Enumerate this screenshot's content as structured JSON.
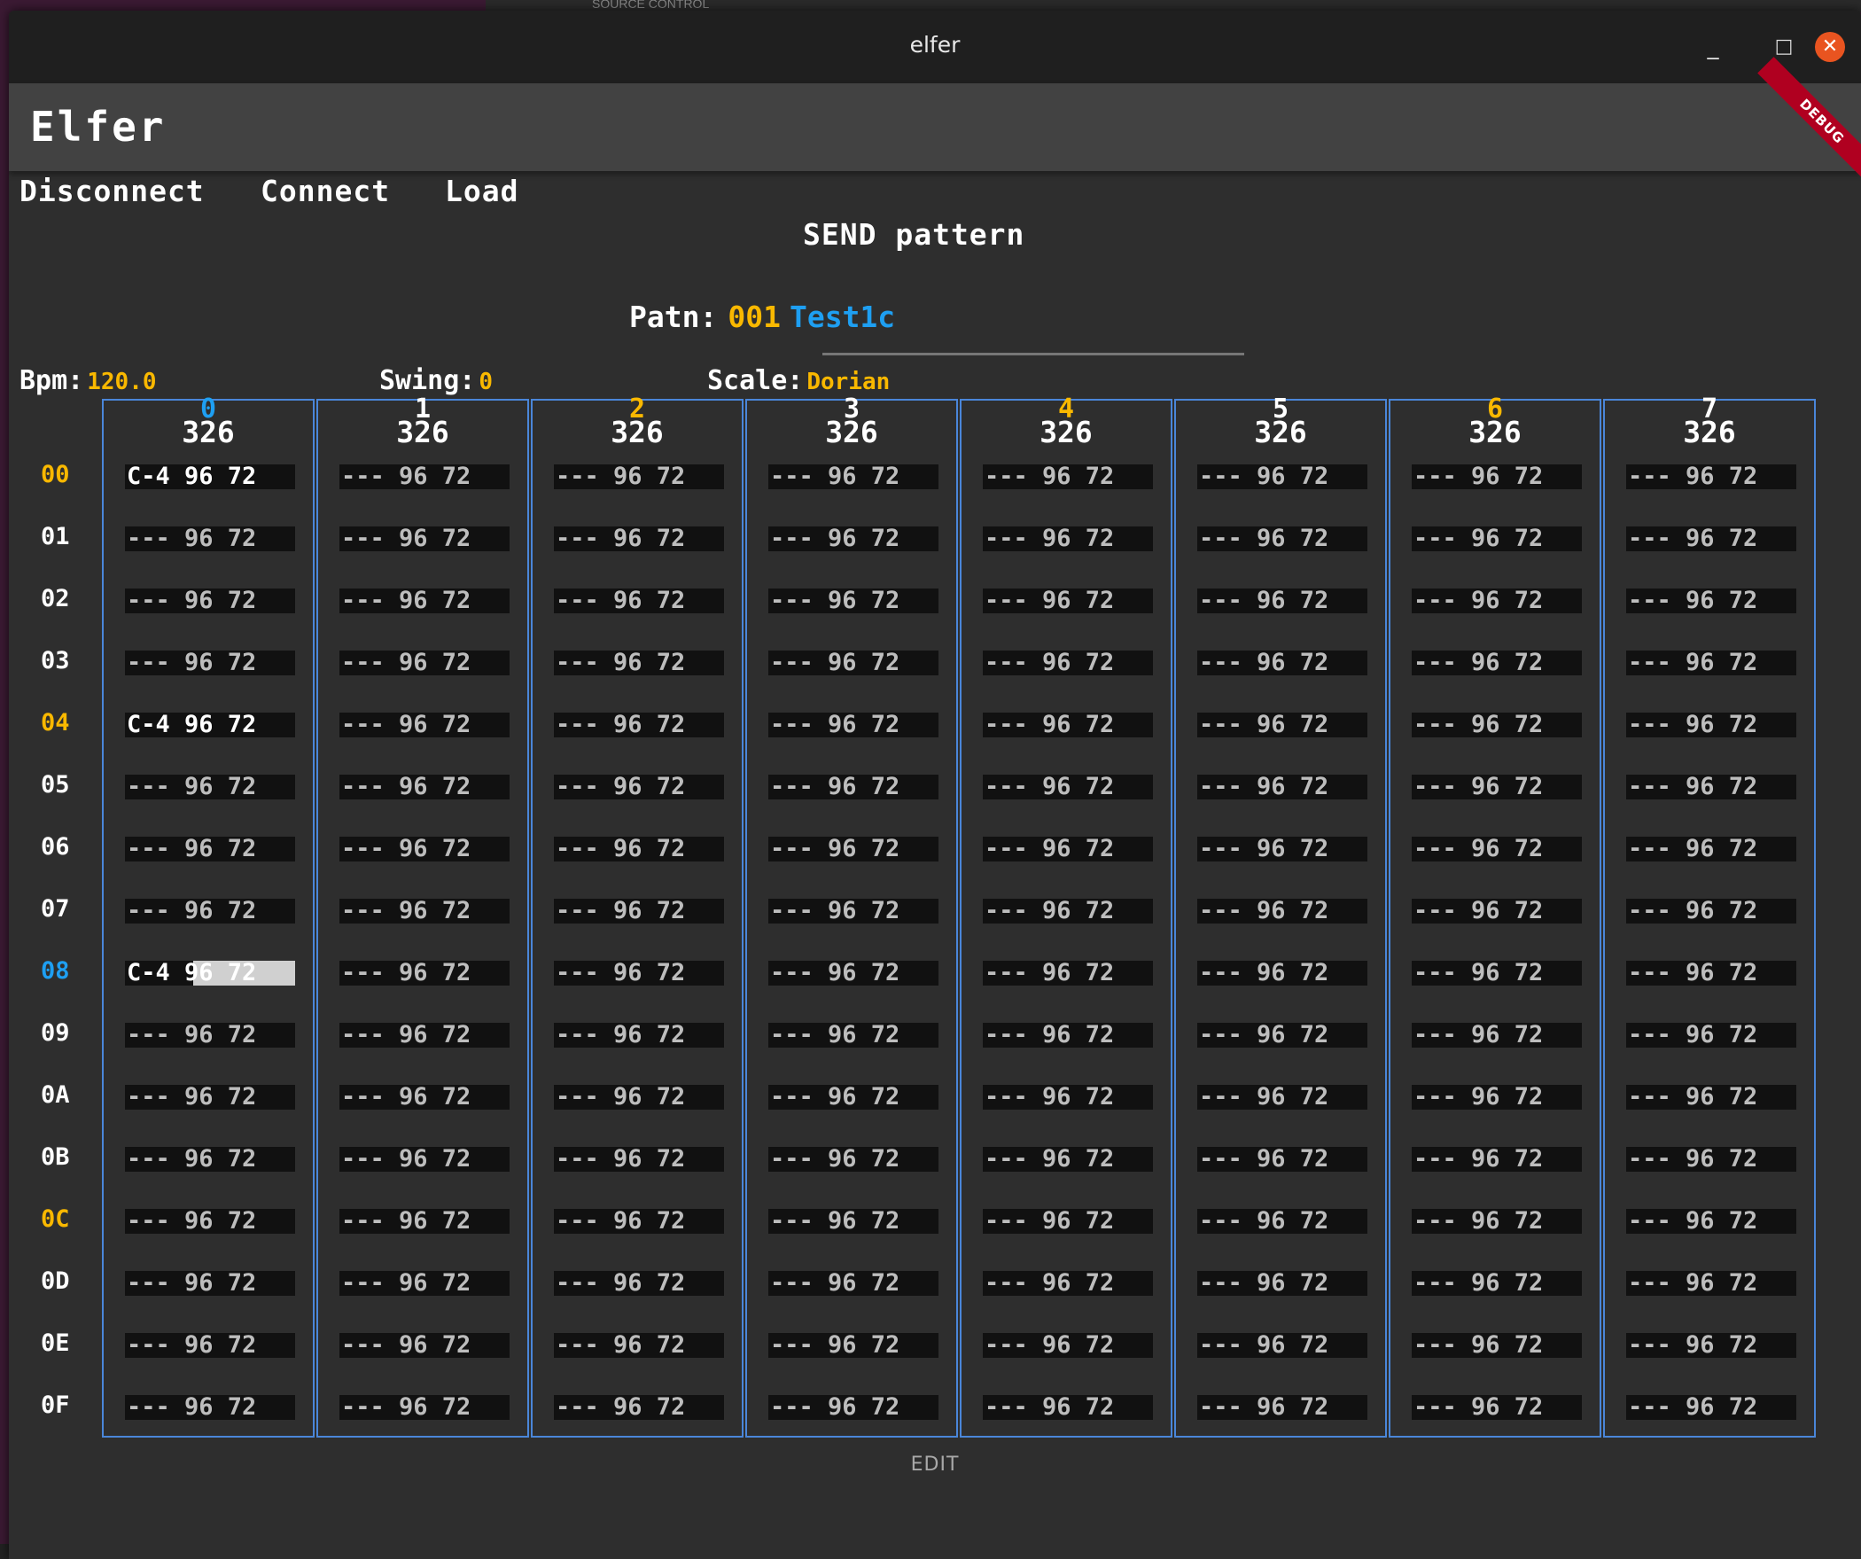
{
  "desktop": {
    "source_control_label": "SOURCE CONTROL"
  },
  "window": {
    "title": "elfer",
    "controls": {
      "minimize": "_",
      "maximize": "□",
      "close": "✕"
    }
  },
  "appbar": {
    "title": "Elfer",
    "debug_badge": "DEBUG"
  },
  "toolbar": {
    "disconnect": "Disconnect",
    "connect": "Connect",
    "load": "Load"
  },
  "send_button": "SEND pattern",
  "pattern": {
    "label": "Patn:",
    "number": "001",
    "name": "Test1c"
  },
  "params": {
    "bpm_label": "Bpm:",
    "bpm_value": "120.0",
    "swing_label": "Swing:",
    "swing_value": "0",
    "scale_label": "Scale:",
    "scale_value": "Dorian"
  },
  "tracks": [
    {
      "number": "0",
      "sub": "326",
      "color": "#1e9ff2"
    },
    {
      "number": "1",
      "sub": "326",
      "color": "#ffffff"
    },
    {
      "number": "2",
      "sub": "326",
      "color": "#f9b800"
    },
    {
      "number": "3",
      "sub": "326",
      "color": "#ffffff"
    },
    {
      "number": "4",
      "sub": "326",
      "color": "#f9b800"
    },
    {
      "number": "5",
      "sub": "326",
      "color": "#ffffff"
    },
    {
      "number": "6",
      "sub": "326",
      "color": "#f9b800"
    },
    {
      "number": "7",
      "sub": "326",
      "color": "#ffffff"
    }
  ],
  "rows": [
    {
      "label": "00",
      "color": "#f9b800"
    },
    {
      "label": "01",
      "color": "#ffffff"
    },
    {
      "label": "02",
      "color": "#ffffff"
    },
    {
      "label": "03",
      "color": "#ffffff"
    },
    {
      "label": "04",
      "color": "#f9b800"
    },
    {
      "label": "05",
      "color": "#ffffff"
    },
    {
      "label": "06",
      "color": "#ffffff"
    },
    {
      "label": "07",
      "color": "#ffffff"
    },
    {
      "label": "08",
      "color": "#1e9ff2"
    },
    {
      "label": "09",
      "color": "#ffffff"
    },
    {
      "label": "0A",
      "color": "#ffffff"
    },
    {
      "label": "0B",
      "color": "#ffffff"
    },
    {
      "label": "0C",
      "color": "#f9b800"
    },
    {
      "label": "0D",
      "color": "#ffffff"
    },
    {
      "label": "0E",
      "color": "#ffffff"
    },
    {
      "label": "0F",
      "color": "#ffffff"
    }
  ],
  "cells": [
    [
      "C-4 96 72",
      "--- 96 72",
      "--- 96 72",
      "--- 96 72",
      "--- 96 72",
      "--- 96 72",
      "--- 96 72",
      "--- 96 72"
    ],
    [
      "--- 96 72",
      "--- 96 72",
      "--- 96 72",
      "--- 96 72",
      "--- 96 72",
      "--- 96 72",
      "--- 96 72",
      "--- 96 72"
    ],
    [
      "--- 96 72",
      "--- 96 72",
      "--- 96 72",
      "--- 96 72",
      "--- 96 72",
      "--- 96 72",
      "--- 96 72",
      "--- 96 72"
    ],
    [
      "--- 96 72",
      "--- 96 72",
      "--- 96 72",
      "--- 96 72",
      "--- 96 72",
      "--- 96 72",
      "--- 96 72",
      "--- 96 72"
    ],
    [
      "C-4 96 72",
      "--- 96 72",
      "--- 96 72",
      "--- 96 72",
      "--- 96 72",
      "--- 96 72",
      "--- 96 72",
      "--- 96 72"
    ],
    [
      "--- 96 72",
      "--- 96 72",
      "--- 96 72",
      "--- 96 72",
      "--- 96 72",
      "--- 96 72",
      "--- 96 72",
      "--- 96 72"
    ],
    [
      "--- 96 72",
      "--- 96 72",
      "--- 96 72",
      "--- 96 72",
      "--- 96 72",
      "--- 96 72",
      "--- 96 72",
      "--- 96 72"
    ],
    [
      "--- 96 72",
      "--- 96 72",
      "--- 96 72",
      "--- 96 72",
      "--- 96 72",
      "--- 96 72",
      "--- 96 72",
      "--- 96 72"
    ],
    [
      "C-4 96 72",
      "--- 96 72",
      "--- 96 72",
      "--- 96 72",
      "--- 96 72",
      "--- 96 72",
      "--- 96 72",
      "--- 96 72"
    ],
    [
      "--- 96 72",
      "--- 96 72",
      "--- 96 72",
      "--- 96 72",
      "--- 96 72",
      "--- 96 72",
      "--- 96 72",
      "--- 96 72"
    ],
    [
      "--- 96 72",
      "--- 96 72",
      "--- 96 72",
      "--- 96 72",
      "--- 96 72",
      "--- 96 72",
      "--- 96 72",
      "--- 96 72"
    ],
    [
      "--- 96 72",
      "--- 96 72",
      "--- 96 72",
      "--- 96 72",
      "--- 96 72",
      "--- 96 72",
      "--- 96 72",
      "--- 96 72"
    ],
    [
      "--- 96 72",
      "--- 96 72",
      "--- 96 72",
      "--- 96 72",
      "--- 96 72",
      "--- 96 72",
      "--- 96 72",
      "--- 96 72"
    ],
    [
      "--- 96 72",
      "--- 96 72",
      "--- 96 72",
      "--- 96 72",
      "--- 96 72",
      "--- 96 72",
      "--- 96 72",
      "--- 96 72"
    ],
    [
      "--- 96 72",
      "--- 96 72",
      "--- 96 72",
      "--- 96 72",
      "--- 96 72",
      "--- 96 72",
      "--- 96 72",
      "--- 96 72"
    ],
    [
      "--- 96 72",
      "--- 96 72",
      "--- 96 72",
      "--- 96 72",
      "--- 96 72",
      "--- 96 72",
      "--- 96 72",
      "--- 96 72"
    ]
  ],
  "selected_cell": {
    "row": 8,
    "col": 0
  },
  "mode_label": "EDIT",
  "colors": {
    "accent_orange": "#f9b800",
    "accent_blue": "#1e9ff2",
    "grid_border": "#4a86d9",
    "close_button": "#e95420"
  }
}
